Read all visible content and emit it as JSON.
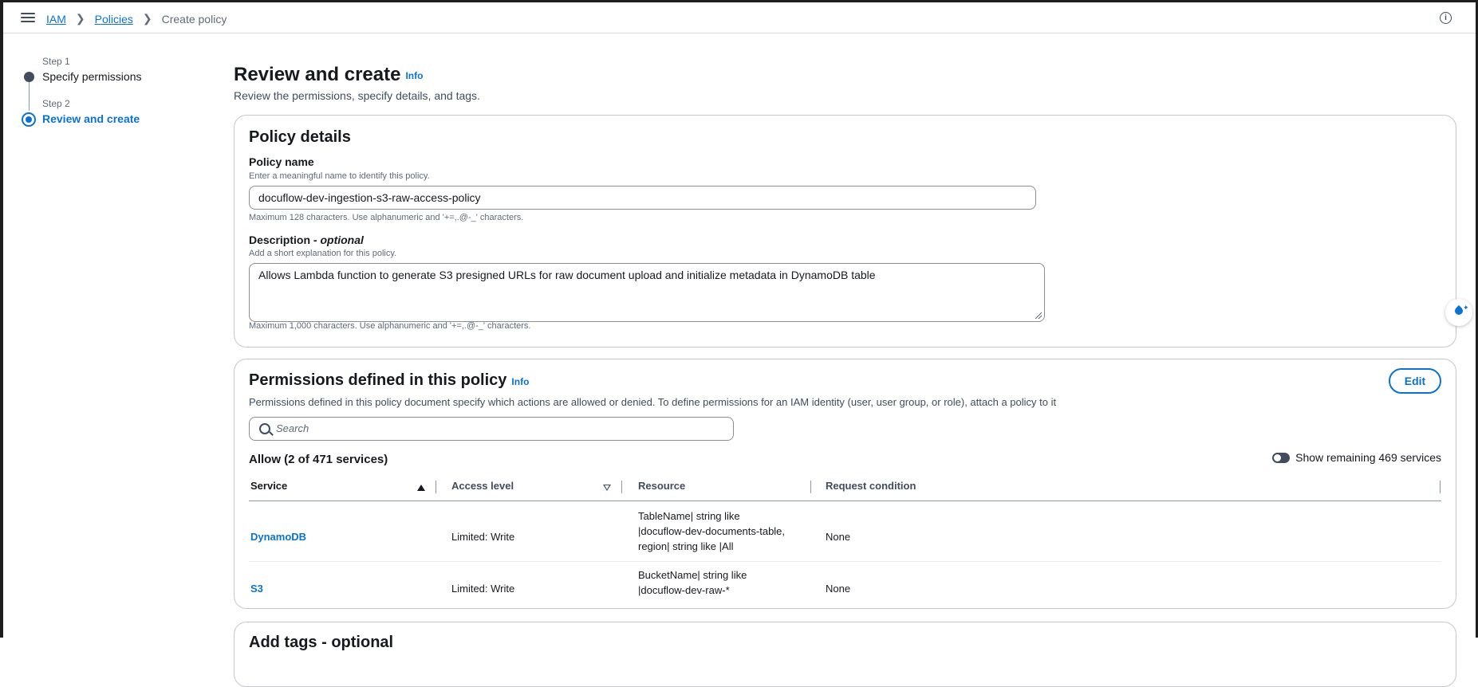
{
  "breadcrumb": {
    "iam": "IAM",
    "policies": "Policies",
    "current": "Create policy"
  },
  "steps": [
    {
      "small": "Step 1",
      "title": "Specify permissions"
    },
    {
      "small": "Step 2",
      "title": "Review and create"
    }
  ],
  "page": {
    "title": "Review and create",
    "info": "Info",
    "subtitle": "Review the permissions, specify details, and tags."
  },
  "policy_details": {
    "heading": "Policy details",
    "name_label": "Policy name",
    "name_hint": "Enter a meaningful name to identify this policy.",
    "name_value": "docuflow-dev-ingestion-s3-raw-access-policy",
    "name_constraint": "Maximum 128 characters. Use alphanumeric and '+=,.@-_' characters.",
    "desc_label": "Description - ",
    "desc_optional": "optional",
    "desc_hint": "Add a short explanation for this policy.",
    "desc_value": "Allows Lambda function to generate S3 presigned URLs for raw document upload and initialize metadata in DynamoDB table",
    "desc_constraint": "Maximum 1,000 characters. Use alphanumeric and '+=,.@-_' characters."
  },
  "permissions": {
    "heading": "Permissions defined in this policy",
    "info": "Info",
    "edit_label": "Edit",
    "description": "Permissions defined in this policy document specify which actions are allowed or denied. To define permissions for an IAM identity (user, user group, or role), attach a policy to it",
    "search_placeholder": "Search",
    "allow_heading": "Allow (2 of 471 services)",
    "toggle_label": "Show remaining 469 services",
    "columns": [
      "Service",
      "Access level",
      "Resource",
      "Request condition"
    ],
    "rows": [
      {
        "service": "DynamoDB",
        "access": "Limited: Write",
        "resource": [
          "TableName| string like",
          "|docuflow-dev-documents-table,",
          "region| string like |All"
        ],
        "condition": "None"
      },
      {
        "service": "S3",
        "access": "Limited: Write",
        "resource": [
          "BucketName| string like",
          "|docuflow-dev-raw-*"
        ],
        "condition": "None"
      }
    ]
  },
  "tags": {
    "heading": "Add tags - optional"
  },
  "icons": {
    "menu": "hamburger-menu-icon",
    "chevron": "chevron-right-icon",
    "info": "info-circle-icon",
    "search": "search-icon",
    "sort": "sort-icon",
    "assistant": "assistant-drop-icon"
  },
  "colors": {
    "link": "#0972d3",
    "text": "#16191f",
    "border": "#c6c6cd"
  }
}
